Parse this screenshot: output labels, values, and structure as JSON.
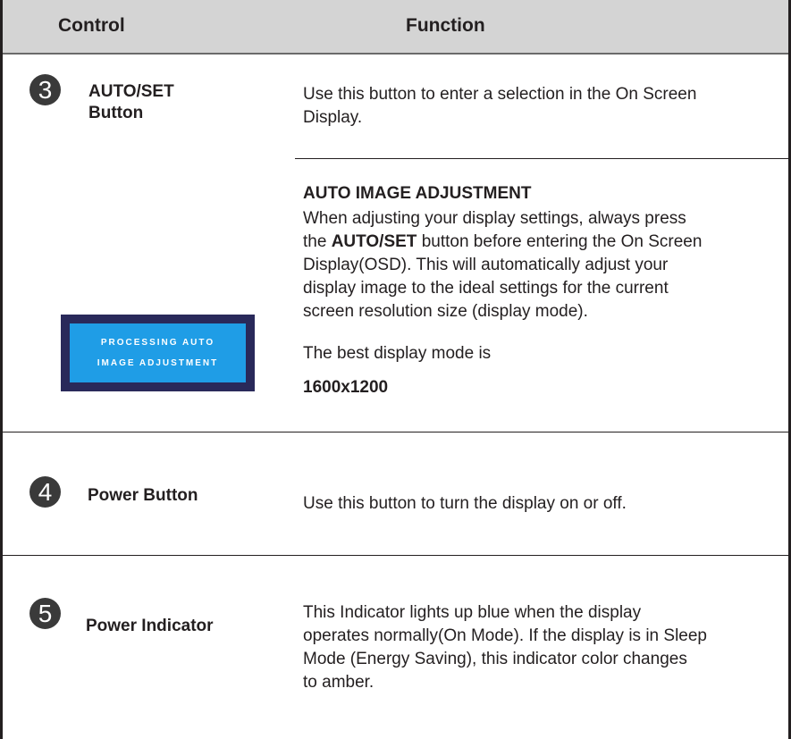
{
  "header": {
    "control": "Control",
    "function": "Function"
  },
  "rows": [
    {
      "number": "3",
      "control_lines": [
        "AUTO/SET",
        "Button"
      ],
      "function_lines": [
        "Use this button to enter a selection in the On Screen",
        "Display."
      ]
    },
    {
      "number": "4",
      "control": "Power Button",
      "function": "Use this button to turn the display on or off."
    },
    {
      "number": "5",
      "control": "Power Indicator",
      "function_lines": [
        "This Indicator lights up blue when the display",
        "operates normally(On Mode). If the display is in Sleep",
        "Mode (Energy Saving), this indicator color changes",
        "to amber."
      ]
    }
  ],
  "auto_adjust": {
    "title": "AUTO IMAGE ADJUSTMENT",
    "line1": "When adjusting your display settings, always press",
    "line2_pre": "the ",
    "line2_bold": "AUTO/SET",
    "line2_post": " button before entering the On Screen",
    "line3": "Display(OSD). This will automatically adjust your",
    "line4": "display image to the ideal settings for the current",
    "line5": "screen resolution size (display mode).",
    "best_mode_label": "The best display mode is",
    "best_mode_value": "1600x1200"
  },
  "osd": {
    "line1": "PROCESSING AUTO",
    "line2": "IMAGE ADJUSTMENT"
  },
  "colors": {
    "header_bg": "#d4d4d4",
    "osd_outer": "#29295a",
    "osd_inner": "#1f9de6",
    "text": "#231f20"
  }
}
